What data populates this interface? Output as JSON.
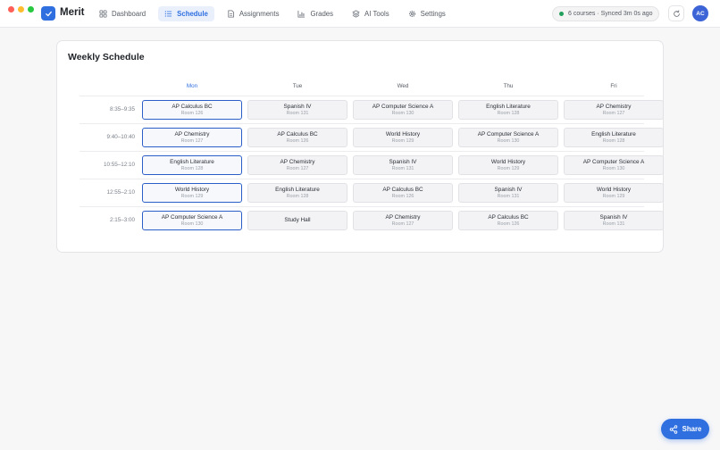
{
  "app": {
    "name": "Merit"
  },
  "nav": [
    {
      "label": "Dashboard",
      "icon": "dashboard-icon",
      "active": false
    },
    {
      "label": "Schedule",
      "icon": "list-icon",
      "active": true
    },
    {
      "label": "Assignments",
      "icon": "document-icon",
      "active": false
    },
    {
      "label": "Grades",
      "icon": "bar-chart-icon",
      "active": false
    },
    {
      "label": "AI Tools",
      "icon": "layers-icon",
      "active": false
    },
    {
      "label": "Settings",
      "icon": "gear-icon",
      "active": false
    }
  ],
  "status": {
    "text": "6 courses · Synced 3m 0s ago",
    "dot_color": "#22a05b"
  },
  "avatar": {
    "initials": "AC"
  },
  "schedule": {
    "title": "Weekly Schedule",
    "days": [
      "Mon",
      "Tue",
      "Wed",
      "Thu",
      "Fri"
    ],
    "active_day": "Mon",
    "periods": [
      {
        "time": "8:35–9:35",
        "cells": [
          {
            "name": "AP Calculus BC",
            "room": "Room 126"
          },
          {
            "name": "Spanish IV",
            "room": "Room 131"
          },
          {
            "name": "AP Computer Science A",
            "room": "Room 130"
          },
          {
            "name": "English Literature",
            "room": "Room 128"
          },
          {
            "name": "AP Chemistry",
            "room": "Room 127"
          }
        ]
      },
      {
        "time": "9:40–10:40",
        "cells": [
          {
            "name": "AP Chemistry",
            "room": "Room 127"
          },
          {
            "name": "AP Calculus BC",
            "room": "Room 126"
          },
          {
            "name": "World History",
            "room": "Room 129"
          },
          {
            "name": "AP Computer Science A",
            "room": "Room 130"
          },
          {
            "name": "English Literature",
            "room": "Room 128"
          }
        ]
      },
      {
        "time": "10:55–12:10",
        "cells": [
          {
            "name": "English Literature",
            "room": "Room 128"
          },
          {
            "name": "AP Chemistry",
            "room": "Room 127"
          },
          {
            "name": "Spanish IV",
            "room": "Room 131"
          },
          {
            "name": "World History",
            "room": "Room 129"
          },
          {
            "name": "AP Computer Science A",
            "room": "Room 130"
          }
        ]
      },
      {
        "time": "12:55–2:10",
        "cells": [
          {
            "name": "World History",
            "room": "Room 129"
          },
          {
            "name": "English Literature",
            "room": "Room 128"
          },
          {
            "name": "AP Calculus BC",
            "room": "Room 126"
          },
          {
            "name": "Spanish IV",
            "room": "Room 131"
          },
          {
            "name": "World History",
            "room": "Room 129"
          }
        ]
      },
      {
        "time": "2:15–3:00",
        "cells": [
          {
            "name": "AP Computer Science A",
            "room": "Room 130"
          },
          {
            "name": "Study Hall",
            "room": ""
          },
          {
            "name": "AP Chemistry",
            "room": "Room 127"
          },
          {
            "name": "AP Calculus BC",
            "room": "Room 126"
          },
          {
            "name": "Spanish IV",
            "room": "Room 131"
          }
        ]
      }
    ]
  },
  "share": {
    "label": "Share"
  },
  "colors": {
    "accent": "#2f6fe0",
    "today_border": "#2b5fc7"
  }
}
